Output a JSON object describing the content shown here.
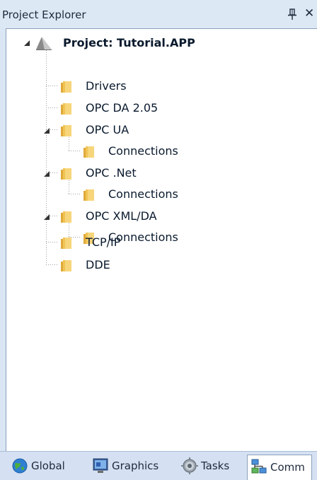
{
  "window": {
    "title": "Project Explorer",
    "pin_glyph": "⫠",
    "close_glyph": "✕"
  },
  "tree": {
    "root": {
      "label": "Project: Tutorial.APP",
      "icon": "project-icon",
      "expanded": true
    },
    "items": [
      {
        "label": "Drivers",
        "icon": "folder-icon",
        "level": 1,
        "expanded": null
      },
      {
        "label": "OPC DA 2.05",
        "icon": "folder-icon",
        "level": 1,
        "expanded": null
      },
      {
        "label": "OPC UA",
        "icon": "folder-icon",
        "level": 1,
        "expanded": true
      },
      {
        "label": "Connections",
        "icon": "folder-icon",
        "level": 2,
        "expanded": null
      },
      {
        "label": "OPC .Net",
        "icon": "folder-icon",
        "level": 1,
        "expanded": true
      },
      {
        "label": "Connections",
        "icon": "folder-icon",
        "level": 2,
        "expanded": null
      },
      {
        "label": "OPC XML/DA",
        "icon": "folder-icon",
        "level": 1,
        "expanded": true
      },
      {
        "label": "Connections",
        "icon": "folder-icon",
        "level": 2,
        "expanded": null
      },
      {
        "label": "TCP/IP",
        "icon": "folder-icon",
        "level": 1,
        "expanded": null
      },
      {
        "label": "DDE",
        "icon": "folder-icon",
        "level": 1,
        "expanded": null
      }
    ]
  },
  "tabs": [
    {
      "label": "Global",
      "icon": "globe-icon",
      "active": false
    },
    {
      "label": "Graphics",
      "icon": "monitor-icon",
      "active": false
    },
    {
      "label": "Tasks",
      "icon": "gear-icon",
      "active": false
    },
    {
      "label": "Comm",
      "icon": "network-icon",
      "active": true
    }
  ],
  "colors": {
    "panel_bg": "#dbe6f4",
    "folder_light": "#f7d57a",
    "folder_dark": "#e0a93a",
    "active_tab": "#ffffff"
  }
}
